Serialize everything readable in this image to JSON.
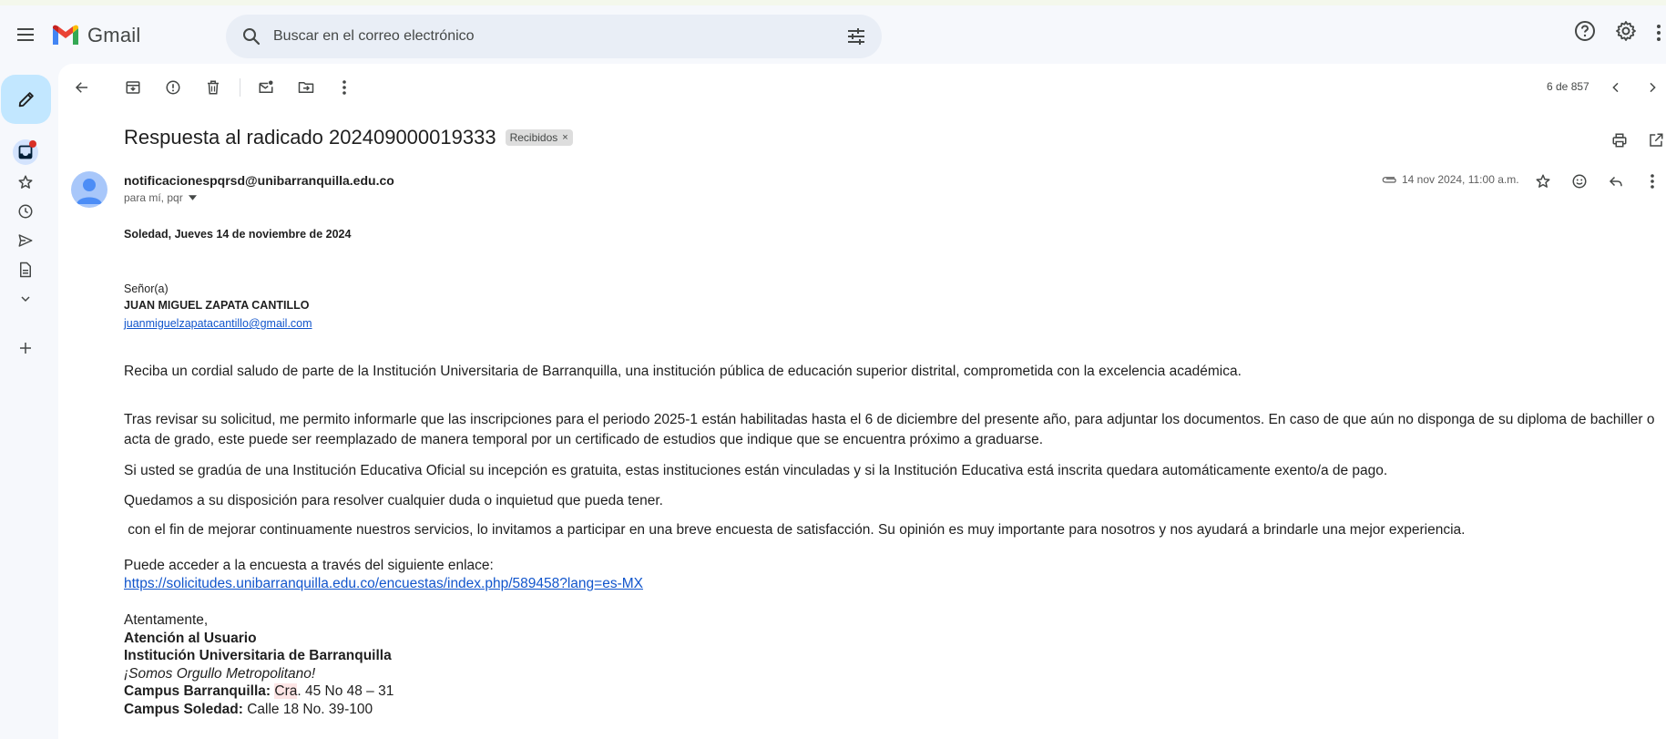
{
  "app": {
    "name": "Gmail"
  },
  "search": {
    "placeholder": "Buscar en el correo electrónico"
  },
  "toolbar": {
    "pager": "6 de 857"
  },
  "email": {
    "subject": "Respuesta al radicado 202409000019333",
    "label": "Recibidos",
    "label_close": "×",
    "sender": "notificacionespqrsd@unibarranquilla.edu.co",
    "recipients": "para mí, pqr",
    "date": "14 nov 2024, 11:00 a.m.",
    "body": {
      "dateline": "Soledad, Jueves 14 de noviembre de 2024",
      "salutation": "Señor(a)",
      "recipient_name": "JUAN MIGUEL ZAPATA CANTILLO",
      "recipient_email": "juanmiguelzapatacantillo@gmail.com",
      "p1": "Reciba un cordial saludo de parte de la Institución Universitaria de Barranquilla, una institución pública de educación superior distrital, comprometida con la excelencia académica.",
      "p2": "Tras revisar su solicitud, me permito informarle que las inscripciones para el periodo 2025-1 están habilitadas hasta el 6 de diciembre del presente año, para adjuntar los documentos. En caso de que aún no disponga de su diploma de bachiller o acta de grado, este puede ser reemplazado de manera temporal por un certificado de estudios que indique que se encuentra próximo a graduarse.",
      "p3": "Si usted se gradúa de una Institución Educativa Oficial su incepción es gratuita, estas instituciones están vinculadas y si la Institución Educativa está inscrita quedara automáticamente exento/a de pago.",
      "p4": "Quedamos a su disposición para resolver cualquier duda o inquietud que pueda tener.",
      "p5": " con el fin de mejorar continuamente nuestros servicios, lo invitamos a participar en una breve encuesta de satisfacción. Su opinión es muy importante para nosotros y nos ayudará a brindarle una mejor experiencia.",
      "survey_intro": "Puede acceder a la encuesta a través del siguiente enlace:",
      "survey_link": "https://solicitudes.unibarranquilla.edu.co/encuestas/index.php/589458?lang=es-MX",
      "closing": "Atentamente,",
      "sig_dept": "Atención al Usuario",
      "sig_org": "Institución Universitaria de Barranquilla",
      "sig_motto": "¡Somos Orgullo Metropolitano!",
      "campus1_label": "Campus Barranquilla:",
      "campus1_addr_hl": "Cra",
      "campus1_addr": ". 45 No 48 – 31",
      "campus2_label": "Campus Soledad:",
      "campus2_addr": " Calle 18 No. 39-100"
    }
  },
  "colors": {
    "compose_bg": "#c2e7ff",
    "search_bg": "#e9eef6",
    "page_bg": "#f6f8fc",
    "link": "#1155cc",
    "label_chip": "#dddddd",
    "unread_dot": "#d93025"
  },
  "icons": {
    "header": [
      "menu-icon",
      "gmail-logo-icon",
      "search-icon",
      "tune-icon",
      "help-icon",
      "settings-icon",
      "apps-icon"
    ],
    "rail": [
      "pencil-icon",
      "inbox-icon",
      "star-icon",
      "clock-icon",
      "send-icon",
      "draft-icon",
      "chevron-down-icon",
      "plus-icon"
    ],
    "toolbar": [
      "back-arrow-icon",
      "archive-icon",
      "report-spam-icon",
      "trash-icon",
      "mark-unread-icon",
      "move-to-icon",
      "more-vert-icon",
      "chevron-left-icon",
      "chevron-right-icon",
      "print-icon",
      "open-new-window-icon"
    ],
    "message": [
      "avatar-icon",
      "paperclip-icon",
      "star-icon",
      "emoji-icon",
      "reply-icon",
      "more-vert-icon",
      "caret-down-icon"
    ]
  }
}
